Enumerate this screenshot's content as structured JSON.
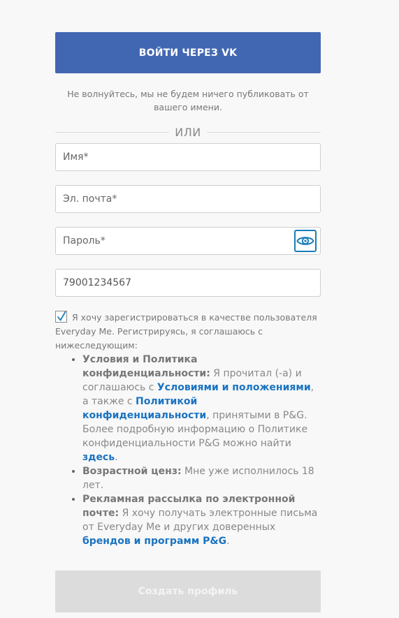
{
  "vk_login": {
    "button_label": "ВОЙТИ ЧЕРЕЗ VK",
    "note": "Не волнуйтесь, мы не будем ничего публиковать от вашего имени."
  },
  "divider": {
    "label": "ИЛИ"
  },
  "fields": {
    "name": {
      "placeholder": "Имя*",
      "value": ""
    },
    "email": {
      "placeholder": "Эл. почта*",
      "value": ""
    },
    "password": {
      "placeholder": "Пароль*",
      "value": ""
    },
    "phone": {
      "placeholder": "",
      "value": "79001234567"
    }
  },
  "icons": {
    "checkbox": "checkmark-icon",
    "password_toggle": "eye-icon"
  },
  "consent": {
    "checked": true,
    "text": "Я хочу зарегистрироваться в качестве пользователя Everyday Me. Регистрируясь, я соглашаюсь с нижеследующим:",
    "terms": {
      "heading": "Условия и Политика конфиденциальности:",
      "text_1": " Я прочитал (-а) и соглашаюсь с ",
      "link_conditions": "Условиями и положениями",
      "text_2": ", а также с ",
      "link_policy": "Политикой конфиденциальности",
      "text_3": ", принятыми в P&G. Более подробную информацию о Политике конфиденциальности P&G можно найти ",
      "link_here": "здесь",
      "text_4": "."
    },
    "age": {
      "heading": "Возрастной ценз:",
      "text": " Мне уже исполнилось 18 лет."
    },
    "newsletter": {
      "heading": "Рекламная рассылка по электронной почте:",
      "text": " Я хочу получать электронные письма от Everyday Me и других доверенных ",
      "link_brands": "брендов и программ P&G",
      "text_end": "."
    }
  },
  "create_profile": {
    "button_label": "Создать профиль"
  },
  "colors": {
    "vk_blue": "#4267b2",
    "link_blue": "#1a73c1",
    "disabled_gray": "#dcdcdc",
    "background": "#f8f8f8"
  }
}
